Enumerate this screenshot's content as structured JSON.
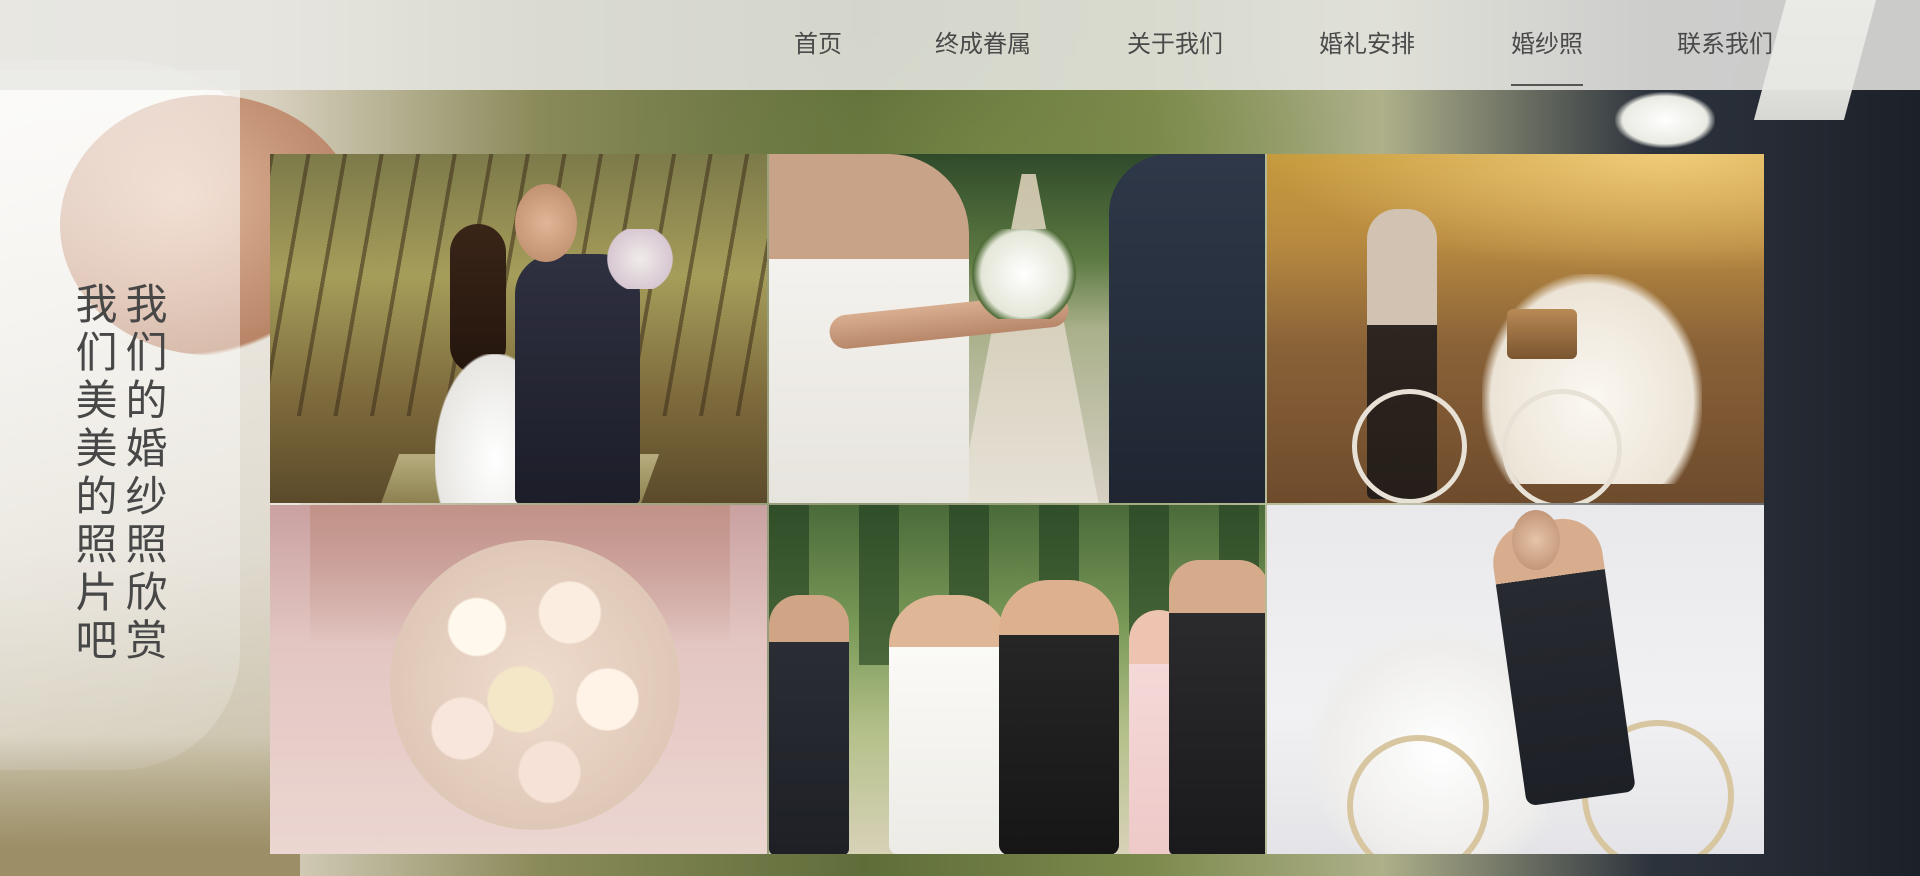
{
  "nav": {
    "items": [
      {
        "label": "首页",
        "active": false
      },
      {
        "label": "终成眷属",
        "active": false
      },
      {
        "label": "关于我们",
        "active": false
      },
      {
        "label": "婚礼安排",
        "active": false
      },
      {
        "label": "婚纱照",
        "active": true
      },
      {
        "label": "联系我们",
        "active": false
      }
    ]
  },
  "side_title": "我们的婚纱照欣赏我们美美的照片吧",
  "gallery": {
    "photos": [
      {
        "name": "photo-forest-kiss"
      },
      {
        "name": "photo-hands-bouquet"
      },
      {
        "name": "photo-sunset-bicycle"
      },
      {
        "name": "photo-rose-bouquet"
      },
      {
        "name": "photo-walking-with-guests"
      },
      {
        "name": "photo-studio-bicycle"
      }
    ]
  },
  "colors": {
    "nav_bg": "#e8e8e4",
    "nav_text": "#4a4a4a",
    "title_text": "#474747"
  }
}
